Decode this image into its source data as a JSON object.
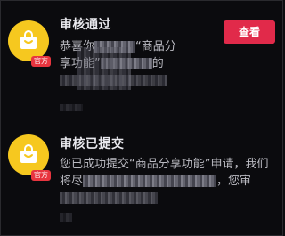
{
  "messages": [
    {
      "title": "审核通过",
      "badge": "官方",
      "button_label": "查看",
      "lines": [
        "恭喜你",
        "“商品分",
        "享功能”",
        "的"
      ]
    },
    {
      "title": "审核已提交",
      "badge": "官方",
      "lines": [
        "您已成功提交“商品分享功能”申请，我们",
        "将尽",
        "，您审"
      ]
    }
  ],
  "colors": {
    "avatar": "#f6c81f",
    "badge": "#e8353f",
    "button": "#e12a4a",
    "background": "#0b0b0e"
  },
  "icons": [
    "shopping-bag-icon"
  ]
}
